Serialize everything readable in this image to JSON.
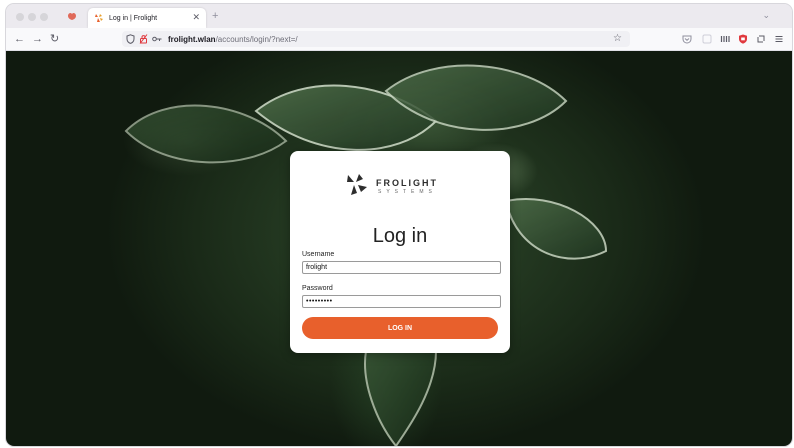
{
  "browser": {
    "tab": {
      "title": "Log in | Frolight"
    },
    "url": {
      "host": "frolight.wlan",
      "path": "/accounts/login/?next=/"
    }
  },
  "login": {
    "logo": {
      "word": "FROLIGHT",
      "sub": "SYSTEMS"
    },
    "heading": "Log in",
    "username_label": "Username",
    "username_value": "frolight",
    "password_label": "Password",
    "password_value": "•••••••••",
    "submit_label": "LOG IN"
  },
  "colors": {
    "accent": "#e8602c",
    "tab_favicon": "#e8602c",
    "shield": "#e0393e"
  },
  "icons": {
    "back": "arrow-left-icon",
    "forward": "arrow-right-icon",
    "reload": "reload-icon",
    "tracking_shield": "tracking-shield-icon",
    "lock": "lock-icon",
    "key": "key-icon",
    "bookmark": "star-icon"
  }
}
